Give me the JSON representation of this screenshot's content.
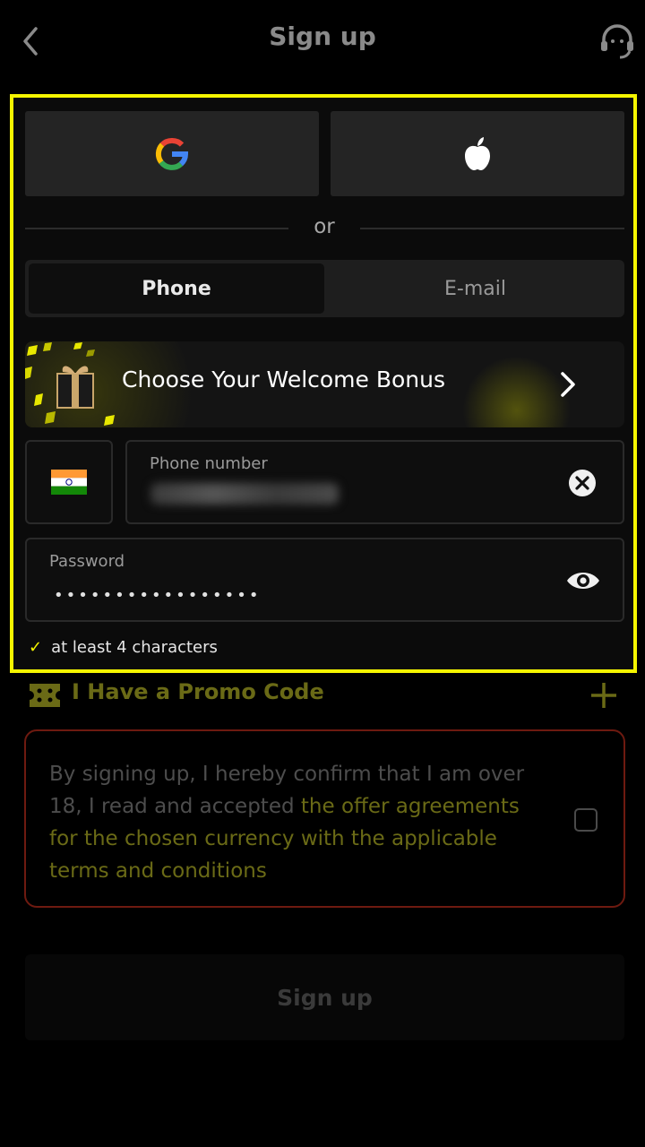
{
  "header": {
    "title": "Sign up",
    "back_icon": "chevron-left-icon",
    "support_icon": "headset-icon"
  },
  "social": {
    "google_icon": "google-icon",
    "apple_icon": "apple-icon"
  },
  "divider": {
    "text": "or"
  },
  "tabs": [
    {
      "label": "Phone",
      "active": true
    },
    {
      "label": "E-mail",
      "active": false
    }
  ],
  "bonus": {
    "label": "Choose Your Welcome Bonus"
  },
  "phone": {
    "label": "Phone number",
    "country_flag": "india-flag-icon"
  },
  "password": {
    "label": "Password",
    "value": "•••••••••••••••••"
  },
  "hint": {
    "text": "at least 4 characters"
  },
  "promo": {
    "label": "I Have a Promo Code"
  },
  "terms": {
    "prefix": "By signing up, I hereby confirm that I am over 18, I read and accepted ",
    "link": "the offer agreements for the chosen currency with the applicable terms and conditions"
  },
  "submit": {
    "label": "Sign up"
  },
  "colors": {
    "accent": "#f5f500",
    "error_border": "#6e1a10",
    "promo": "#6a6a16"
  }
}
